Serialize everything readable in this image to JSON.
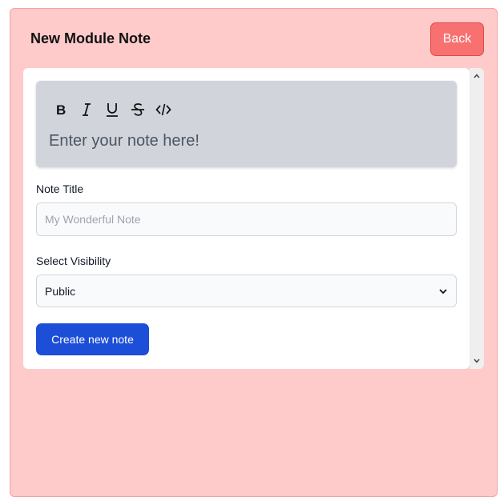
{
  "header": {
    "title": "New Module Note",
    "back_label": "Back"
  },
  "editor": {
    "toolbar": [
      {
        "icon": "bold-icon",
        "label": "B"
      },
      {
        "icon": "italic-icon",
        "label": "I"
      },
      {
        "icon": "underline-icon",
        "label": "U"
      },
      {
        "icon": "strikethrough-icon",
        "label": "S"
      },
      {
        "icon": "code-icon",
        "label": "</>"
      }
    ],
    "placeholder": "Enter your note here!"
  },
  "form": {
    "title_label": "Note Title",
    "title_placeholder": "My Wonderful Note",
    "title_value": "",
    "visibility_label": "Select Visibility",
    "visibility_value": "Public",
    "submit_label": "Create new note"
  },
  "colors": {
    "panel_bg": "#fecaca",
    "back_button": "#f87171",
    "editor_bg": "#d1d5db",
    "primary_button": "#1d4ed8"
  }
}
